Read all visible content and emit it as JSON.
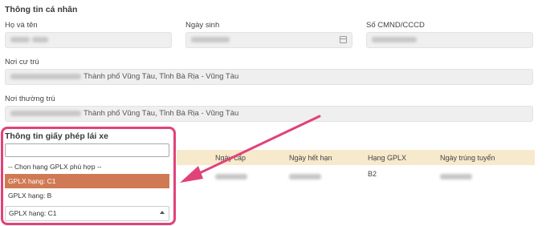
{
  "personal": {
    "title": "Thông tin cá nhân",
    "name_label": "Họ và tên",
    "dob_label": "Ngày sinh",
    "id_label": "Số CMND/CCCD",
    "residence_label": "Nơi cư trú",
    "residence_value": "Thành phố Vũng Tàu, Tỉnh Bà Rịa - Vũng Tàu",
    "permanent_label": "Nơi thường trú",
    "permanent_value": "Thành phố Vũng Tàu, Tỉnh Bà Rịa - Vũng Tàu"
  },
  "license": {
    "title": "Thông tin giấy phép lái xe",
    "columns": [
      "Ngày cấp",
      "Ngày hết hạn",
      "Hạng GPLX",
      "Ngày trúng tuyển"
    ],
    "row": {
      "class": "B2"
    }
  },
  "dropdown": {
    "search_value": "",
    "options": [
      "-- Chọn hạng GPLX phù hợp --",
      "GPLX hạng: C1",
      "GPLX hạng: B"
    ],
    "highlighted_index": 1,
    "selected_value": "GPLX hạng: C1"
  },
  "colors": {
    "accent": "#e0427a",
    "highlight_option": "#d07a55",
    "table_header": "#f7e9cc"
  }
}
